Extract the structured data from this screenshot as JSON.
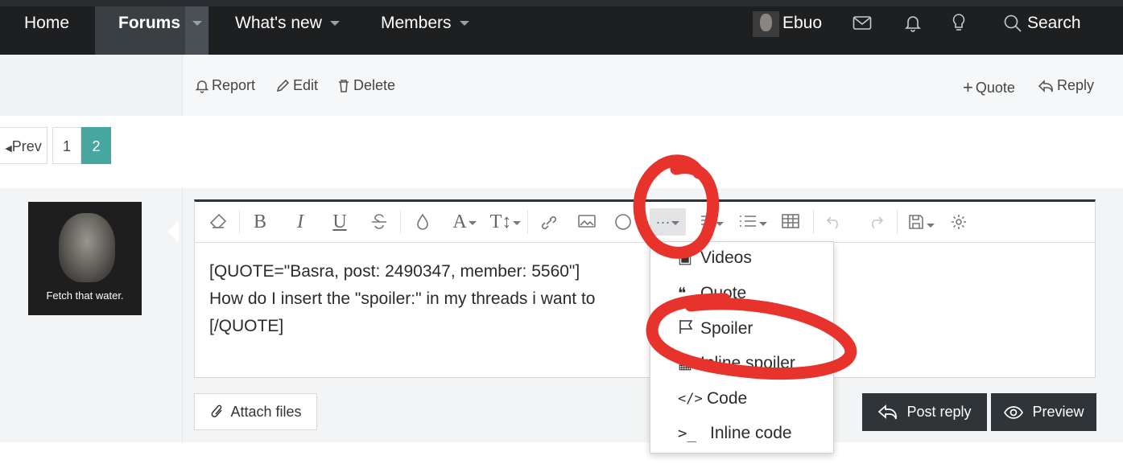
{
  "nav": {
    "home": "Home",
    "forums": "Forums",
    "whats_new": "What's new",
    "members": "Members",
    "username": "Ebuo",
    "search": "Search"
  },
  "post_actions": {
    "report": "Report",
    "edit": "Edit",
    "delete": "Delete",
    "quote": "Quote",
    "reply": "Reply"
  },
  "pagination": {
    "prev": "Prev",
    "pages": [
      "1",
      "2"
    ],
    "current": "2"
  },
  "avatar": {
    "caption": "Fetch that water."
  },
  "editor": {
    "lines": [
      "[QUOTE=\"Basra, post: 2490347, member: 5560\"]",
      "How do I insert the \"spoiler:\" in my threads  i want to",
      "[/QUOTE]"
    ],
    "toolbar": {
      "bold": "B",
      "italic": "I",
      "underline": "U",
      "font": "A",
      "size": "T↕",
      "more": "···"
    }
  },
  "insert_menu": {
    "items": [
      {
        "label": "Videos",
        "icon": "video-icon"
      },
      {
        "label": "Quote",
        "icon": "quote-icon"
      },
      {
        "label": "Spoiler",
        "icon": "flag-icon"
      },
      {
        "label": "Inline spoiler",
        "icon": "inline-spoiler-icon"
      },
      {
        "label": "Code",
        "icon": "code-icon"
      },
      {
        "label": "Inline code",
        "icon": "terminal-icon"
      }
    ]
  },
  "buttons": {
    "attach": "Attach files",
    "post_reply": "Post reply",
    "preview": "Preview"
  },
  "colors": {
    "nav_bg": "#1d1f21",
    "accent_page": "#47a7a0",
    "dark_button": "#2f3438",
    "annotation": "#e8322c"
  }
}
